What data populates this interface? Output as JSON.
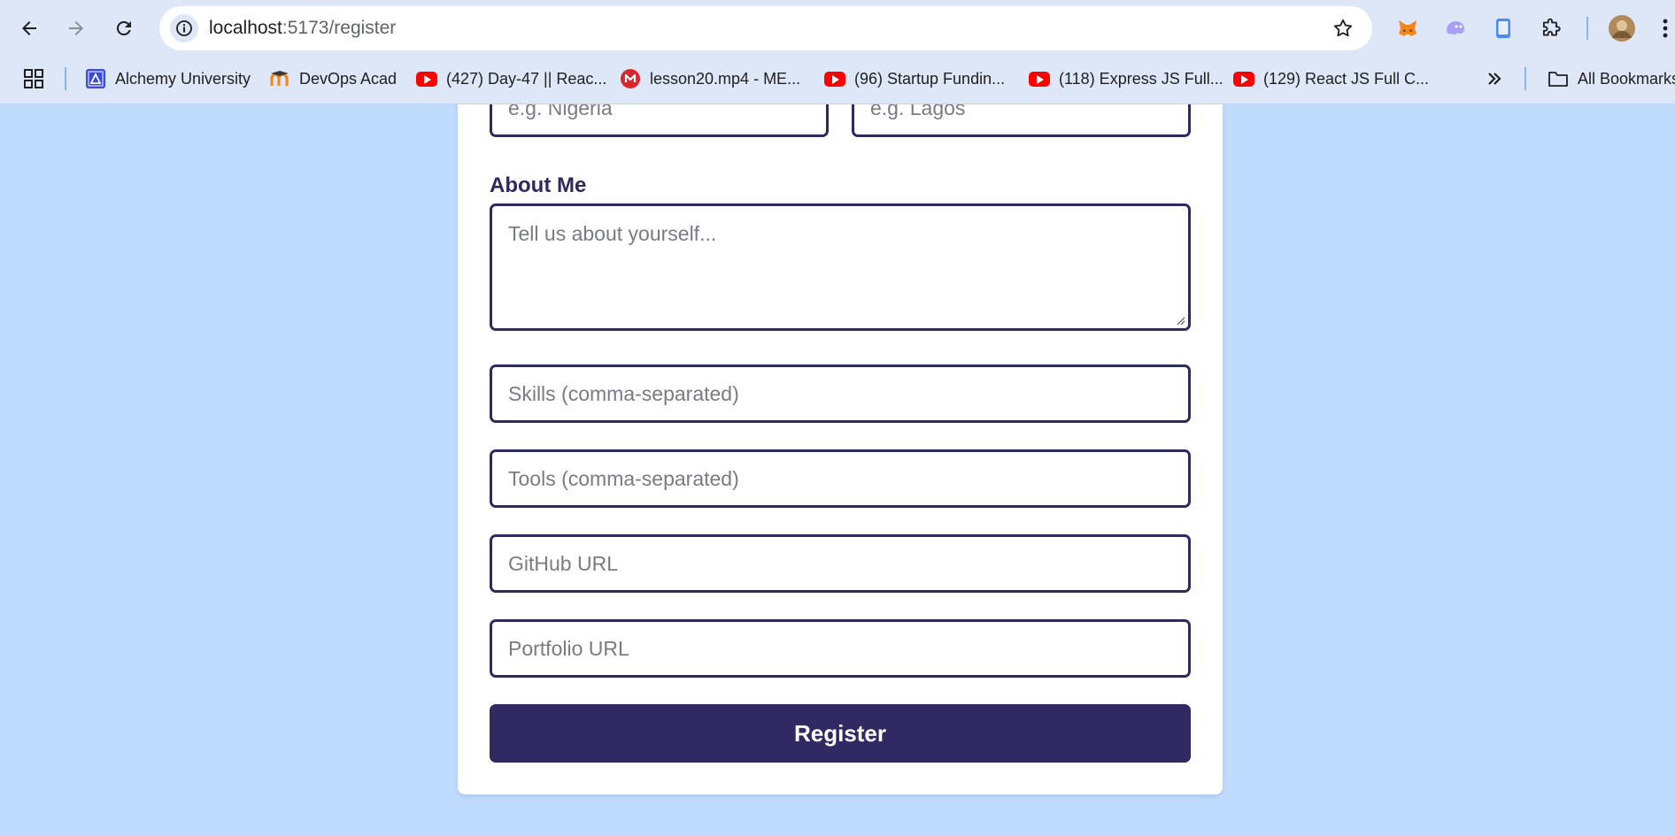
{
  "browser": {
    "url_host": "localhost",
    "url_path": ":5173/register",
    "bookmarks": [
      {
        "label": "Alchemy University",
        "icon": "alchemy-icon"
      },
      {
        "label": "DevOps Acad",
        "icon": "devops-icon"
      },
      {
        "label": "(427) Day-47 || Reac...",
        "icon": "youtube-icon"
      },
      {
        "label": "lesson20.mp4 - ME...",
        "icon": "mega-icon"
      },
      {
        "label": "(96) Startup Fundin...",
        "icon": "youtube-icon"
      },
      {
        "label": "(118) Express JS Full...",
        "icon": "youtube-icon"
      },
      {
        "label": "(129) React JS Full C...",
        "icon": "youtube-icon"
      }
    ],
    "all_bookmarks_label": "All Bookmarks"
  },
  "form": {
    "country_placeholder": "e.g. Nigeria",
    "city_placeholder": "e.g. Lagos",
    "about_label": "About Me",
    "about_placeholder": "Tell us about yourself...",
    "skills_placeholder": "Skills (comma-separated)",
    "tools_placeholder": "Tools (comma-separated)",
    "github_placeholder": "GitHub URL",
    "portfolio_placeholder": "Portfolio URL",
    "submit_label": "Register"
  },
  "colors": {
    "page_bg": "#bfdbfe",
    "accent": "#312a62",
    "border": "#2d2a5e"
  }
}
